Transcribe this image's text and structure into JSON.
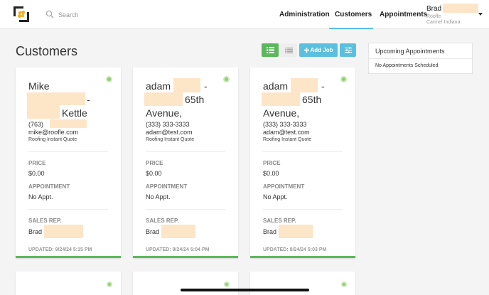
{
  "search": {
    "placeholder": "Search"
  },
  "nav": {
    "items": [
      {
        "label": "Administration"
      },
      {
        "label": "Customers",
        "active": true
      },
      {
        "label": "Appointments"
      }
    ]
  },
  "user": {
    "name": "Brad",
    "company": "Roofle",
    "location": "Carmel Indiana"
  },
  "page": {
    "title": "Customers"
  },
  "toolbar": {
    "add_job_label": "Add Job"
  },
  "cards": [
    {
      "name_line1": "Mike",
      "name_dash": "-",
      "name_line3": "Kettle",
      "phone": "(763)",
      "email": "mike@roofle.com",
      "source": "Roofing Instant Quote",
      "price_label": "PRICE",
      "price": "$0.00",
      "appointment_label": "APPOINTMENT",
      "appointment": "No Appt.",
      "sales_rep_label": "SALES REP.",
      "sales_rep": "Brad",
      "updated": "UPDATED: 9/24/24 5:15 PM"
    },
    {
      "name_line1": "adam",
      "name_dash": "-",
      "name_line2": "65th",
      "name_line3": "Avenue,",
      "phone": "(333) 333-3333",
      "email": "adam@test.com",
      "source": "Roofing Instant Quote",
      "price_label": "PRICE",
      "price": "$0.00",
      "appointment_label": "APPOINTMENT",
      "appointment": "No Appt.",
      "sales_rep_label": "SALES REP.",
      "sales_rep": "Brad",
      "updated": "UPDATED: 9/24/24 5:04 PM"
    },
    {
      "name_line1": "adam",
      "name_dash": "-",
      "name_line2": "65th",
      "name_line3": "Avenue,",
      "phone": "(333) 333-3333",
      "email": "adam@test.com",
      "source": "Roofing Instant Quote",
      "price_label": "PRICE",
      "price": "$0.00",
      "appointment_label": "APPOINTMENT",
      "appointment": "No Appt.",
      "sales_rep_label": "SALES REP.",
      "sales_rep": "Brad",
      "updated": "UPDATED: 9/24/24 5:03 PM"
    }
  ],
  "upcoming": {
    "title": "Upcoming Appointments",
    "empty": "No Appointments Scheduled"
  },
  "colors": {
    "accent": "#5bc0de",
    "success": "#5cb85c",
    "redaction": "#fde5c8"
  }
}
